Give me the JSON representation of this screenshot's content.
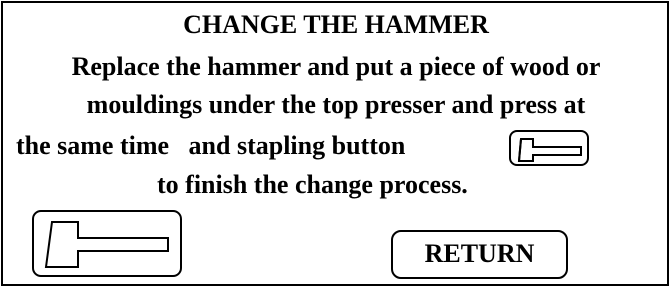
{
  "dialog": {
    "title": "CHANGE THE HAMMER",
    "instruction_line1": "Replace the hammer and put a piece of wood or",
    "instruction_line2": "mouldings under the top presser and press at",
    "instruction_line3": "the same time   and stapling button",
    "instruction_line4": "to finish the change process."
  },
  "buttons": {
    "hammer_icon": "hammer-icon",
    "return_label": "RETURN"
  }
}
